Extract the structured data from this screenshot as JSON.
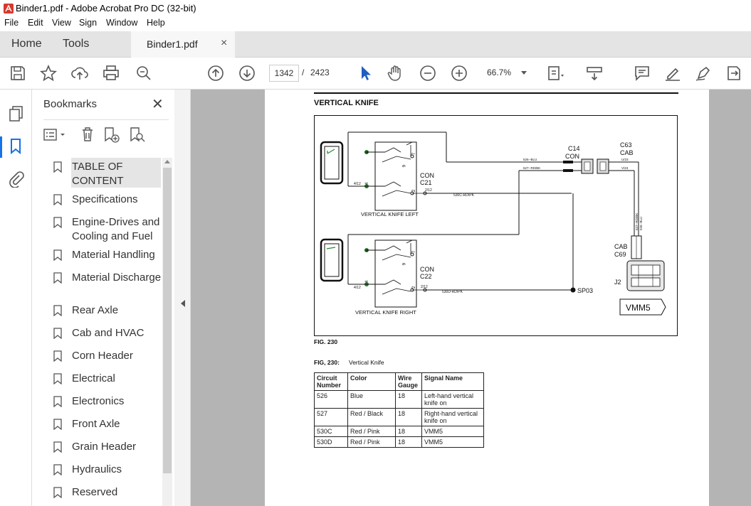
{
  "window": {
    "title": "Binder1.pdf - Adobe Acrobat Pro DC (32-bit)"
  },
  "menu": [
    "File",
    "Edit",
    "View",
    "Sign",
    "Window",
    "Help"
  ],
  "tabs": {
    "home": "Home",
    "tools": "Tools",
    "document": "Binder1.pdf",
    "close": "×"
  },
  "toolbar": {
    "current_page": "1342",
    "page_separator": "/",
    "total_pages": "2423",
    "zoom": "66.7%"
  },
  "bookmarks": {
    "title": "Bookmarks",
    "items": [
      "TABLE OF CONTENT",
      "Specifications",
      "Engine-Drives and Cooling and Fuel",
      "Material Handling",
      "Material Discharge",
      "Rear Axle",
      "Cab and HVAC",
      "Corn Header",
      "Electrical",
      "Electronics",
      "Front Axle",
      "Grain Header",
      "Hydraulics",
      "Reserved"
    ]
  },
  "document": {
    "section_title": "VERTICAL KNIFE",
    "figure_label": "FIG. 230",
    "caption_label": "FIG, 230:",
    "caption_text": "Vertical Knife",
    "diagram": {
      "con_c21": [
        "CON",
        "C21"
      ],
      "con_c22": [
        "CON",
        "C22"
      ],
      "c14": [
        "C14",
        "CON"
      ],
      "c63": [
        "C63",
        "CAB"
      ],
      "cab_c69": [
        "CAB",
        "C69"
      ],
      "left_switch": "VERTICAL KNIFE LEFT",
      "right_switch": "VERTICAL KNIFE RIGHT",
      "sp03": "SP03",
      "j2": "J2",
      "vmm5": "VMM5",
      "pin8": "8",
      "pin4": "4",
      "pin6": "6",
      "pin7": "7",
      "pin2": "2",
      "wire_526": "526--BLU",
      "wire_527": "527--RD/BK",
      "wire_530c": "530C-RD/PK",
      "wire_530d": "530D-RD/PK",
      "ref_412": "4/12",
      "ref_212": "2/12",
      "ref_u23": "U/23",
      "ref_v23": "V/23"
    },
    "table": {
      "headers": [
        "Circuit Number",
        "Color",
        "Wire Gauge",
        "Signal Name"
      ],
      "rows": [
        [
          "526",
          "Blue",
          "18",
          "Left-hand vertical knife on"
        ],
        [
          "527",
          "Red / Black",
          "18",
          "Right-hand vertical knife on"
        ],
        [
          "530C",
          "Red / Pink",
          "18",
          "VMM5"
        ],
        [
          "530D",
          "Red / Pink",
          "18",
          "VMM5"
        ]
      ]
    }
  }
}
